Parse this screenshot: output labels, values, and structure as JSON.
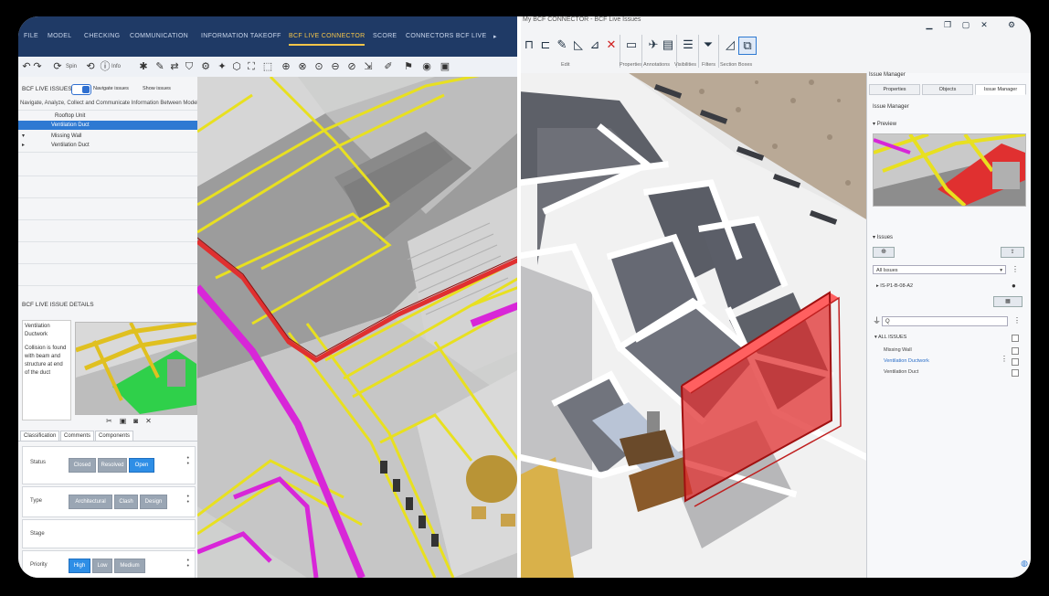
{
  "left": {
    "tabs": [
      "FILE",
      "MODEL",
      "CHECKING",
      "COMMUNICATION",
      "INFORMATION TAKEOFF",
      "BCF LIVE CONNECTOR",
      "SCORE",
      "CONNECTORS BCF LIVE"
    ],
    "active_tab_index": 5,
    "toolbar": {
      "label1": "Spin",
      "label2": "Info"
    },
    "sidebar": {
      "header": "BCF LIVE ISSUES",
      "options": [
        "Navigate issues",
        "Show issues"
      ],
      "caption": "Navigate, Analyze, Collect and Communicate Information Between Models in Central",
      "rows": [
        {
          "name": "Ventilation Duct",
          "highlight": true
        },
        {
          "name": "Rooftop Unit",
          "highlight": false
        },
        {
          "name": "Missing Wall",
          "highlight": false
        },
        {
          "name": "Ventilation Duct",
          "highlight": false
        }
      ],
      "detail_header": "BCF LIVE ISSUE DETAILS",
      "detail_title": "Ventilation Ductwork",
      "detail_desc": "Collision is found with beam and structure at end of the duct",
      "subtabs": [
        "Classification",
        "Comments",
        "Components"
      ],
      "status_label": "Status",
      "status_options": [
        "Closed",
        "Resolved",
        "Open"
      ],
      "status_selected": 2,
      "type_label": "Type",
      "type_options": [
        "Architectural",
        "Clash",
        "Design"
      ],
      "stage_label": "Stage",
      "priority_label": "Priority",
      "priority_options": [
        "High",
        "Low",
        "Medium"
      ],
      "priority_selected": 0
    }
  },
  "right": {
    "title": "My BCF CONNECTOR - BCF Live Issues",
    "tool_groups": [
      "Edit",
      "Properties",
      "Annotations",
      "Visibilities",
      "Filters",
      "Section Boxes"
    ],
    "panel": {
      "title": "Issue Manager",
      "tabs": [
        "Properties",
        "Objects",
        "Issue Manager"
      ],
      "active_tab": 2,
      "issue_label": "Issue Manager",
      "preview_label": "Preview",
      "issues_label": "Issues",
      "filter_value": "All Issues",
      "issue_id": "IS-P1-B-08-A2",
      "search_placeholder": "Q",
      "group_label": "ALL ISSUES",
      "items": [
        "Missing Wall",
        "Ventilation Ductwork",
        "Ventilation Duct"
      ],
      "selected_item": 1
    }
  },
  "colors": {
    "accent": "#2e79d2",
    "tab_active": "#f5c54a",
    "clash_red": "#e03030",
    "pipe_magenta": "#d826d8",
    "duct_yellow": "#e8e020",
    "clash_green": "#2fd04a"
  }
}
